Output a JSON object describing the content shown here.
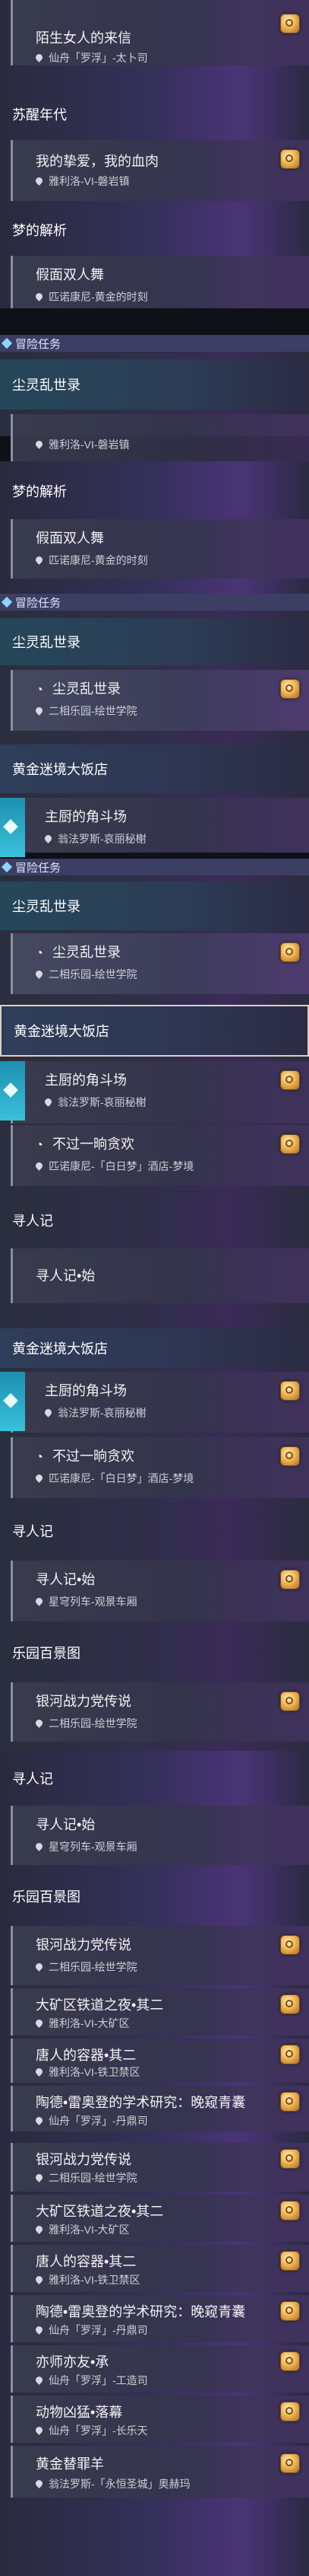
{
  "quests": {
    "stranger_letter": {
      "title": "陌生女人的来信",
      "loc": "仙舟「罗浮」-太卜司"
    },
    "my_beloved": {
      "title": "我的挚爱，我的血肉",
      "loc": "雅利洛-VI-磐岩镇"
    },
    "masquerade": {
      "title": "假面双人舞",
      "loc": "匹诺康尼-黄金的时刻"
    },
    "stardust_item": {
      "title": "尘灵乱世录",
      "loc": "二相乐园-绘世学院"
    },
    "chef_arena": {
      "title": "主厨的角斗场",
      "loc": "翁法罗斯-哀丽秘榭"
    },
    "no_feast": {
      "title": "不过一晌贪欢",
      "loc": "匹诺康尼-「白日梦」酒店-梦境"
    },
    "seek_start": {
      "title": "寻人记•始",
      "loc": "星穹列车-观景车厢"
    },
    "galaxy_legend": {
      "title": "银河战力党传说",
      "loc": "二相乐园-绘世学院"
    },
    "railway_night": {
      "title": "大矿区铁道之夜•其二",
      "loc": "雅利洛-VI-大矿区"
    },
    "tang_vessel": {
      "title": "唐人的容器•其二",
      "loc": "雅利洛-VI-铁卫禁区"
    },
    "research": {
      "title": "陶德•雷奥登的学术研究：晚窥青囊",
      "loc": "仙舟「罗浮」-丹鼎司"
    },
    "master_pupil": {
      "title": "亦师亦友•承",
      "loc": "仙舟「罗浮」-工造司"
    },
    "beast_fall": {
      "title": "动物凶猛•落幕",
      "loc": "仙舟「罗浮」-长乐天"
    },
    "golden_fleece": {
      "title": "黄金替罪羊",
      "loc": "翁法罗斯-「永恒圣城」奥赫玛"
    }
  },
  "groups": {
    "awakening": "苏醒年代",
    "dream": "梦的解析",
    "stardust": "尘灵乱世录",
    "grand_hotel": "黄金迷境大饭店",
    "seek": "寻人记",
    "park": "乐园百景图"
  },
  "section_label": "冒险任务",
  "cut_text": {
    "c1": "我的挚爱，我的血肉",
    "c1_loc": "雅利洛-VI-磐岩镇"
  }
}
